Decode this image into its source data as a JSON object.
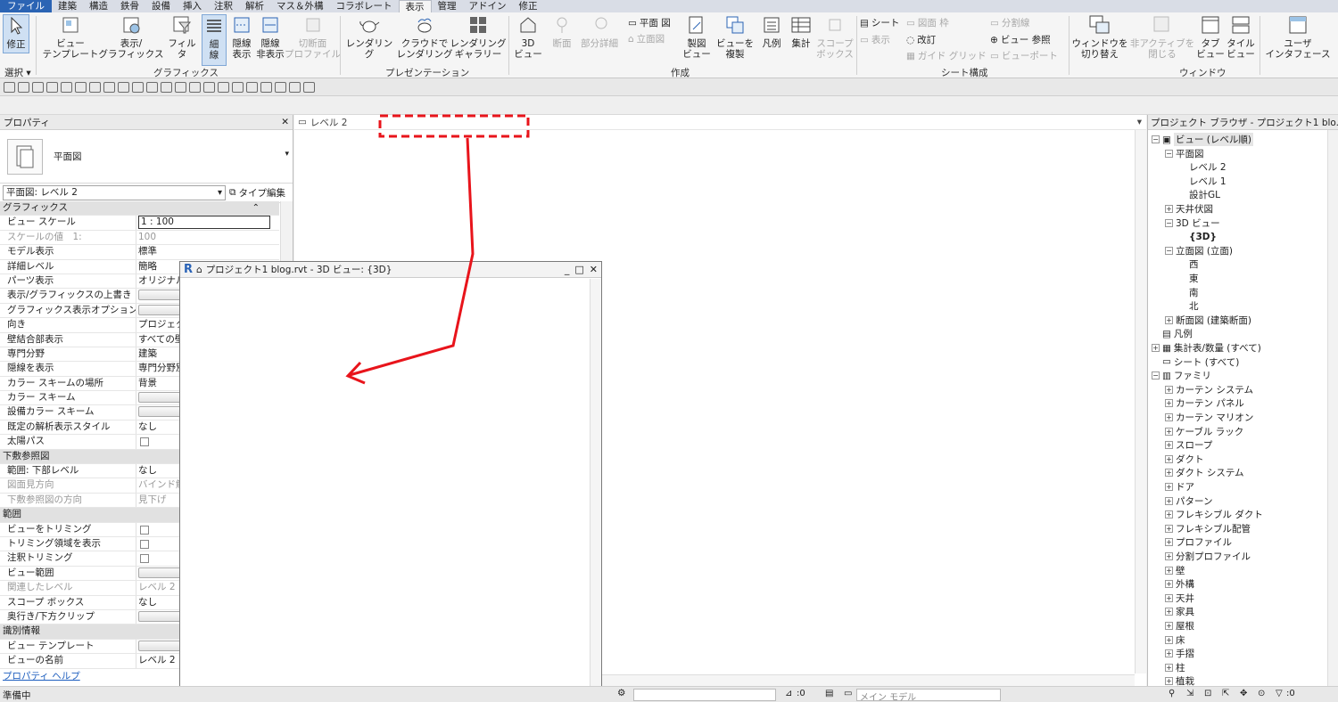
{
  "menu": [
    "ファイル",
    "建築",
    "構造",
    "鉄骨",
    "設備",
    "挿入",
    "注釈",
    "解析",
    "マス＆外構",
    "コラボレート",
    "表示",
    "管理",
    "アドイン",
    "修正"
  ],
  "ribbon": {
    "modify": "修正",
    "select": "選択 ▾",
    "view_template": "ビュー\nテンプレート",
    "vis_graphics": "表示/\nグラフィックス",
    "filter": "フィルタ",
    "thin_lines": "細\n線",
    "show_hidden": "隠線\n表示",
    "remove_hidden": "隠線\n非表示",
    "cut_profile": "切断面\nプロファイル",
    "group_graphics": "グラフィックス",
    "render": "レンダリング",
    "cloud_render": "クラウドで\nレンダリング",
    "render_gallery": "レンダリング\nギャラリー",
    "group_presentation": "プレゼンテーション",
    "view_3d": "3D\nビュー",
    "section": "断面",
    "callout": "部分詳細",
    "plan_view": "平面 図",
    "elevation": "立面図",
    "drafting_view": "製図\nビュー",
    "duplicate_view": "ビューを\n複製",
    "legends": "凡例",
    "schedules": "集計",
    "scope_box": "スコープ\nボックス",
    "group_create": "作成",
    "sheet": "シート",
    "title_block": "図面 枠",
    "view": "表示",
    "revision": "改訂",
    "guide_grid": "ガイド グリッド",
    "matchline": "分割線",
    "view_reference": "ビュー 参照",
    "viewports": "ビューポート",
    "group_sheet": "シート構成",
    "switch_windows": "ウィンドウを\n切り替え",
    "close_inactive": "非アクティブを\n閉じる",
    "tab_views": "タブ\nビュー",
    "tile_views": "タイル\nビュー",
    "group_window": "ウィンドウ",
    "user_interface": "ユーザ\nインタフェース"
  },
  "properties": {
    "title": "プロパティ",
    "type_name": "平面図",
    "instance_selector": "平面図: レベル 2",
    "edit_type": "タイプ編集",
    "help": "プロパティ ヘルプ",
    "rows": [
      {
        "k": "グラフィックス",
        "sec": true,
        "v": ""
      },
      {
        "k": "ビュー スケール",
        "v": "1 : 100",
        "kind": "input"
      },
      {
        "k": "スケールの値　1:",
        "v": "100",
        "dim": true
      },
      {
        "k": "モデル表示",
        "v": "標準"
      },
      {
        "k": "詳細レベル",
        "v": "簡略"
      },
      {
        "k": "パーツ表示",
        "v": "オリジナル"
      },
      {
        "k": "表示/グラフィックスの上書き",
        "v": "",
        "kind": "button"
      },
      {
        "k": "グラフィックス表示オプション",
        "v": "",
        "kind": "button"
      },
      {
        "k": "向き",
        "v": "プロジェクト"
      },
      {
        "k": "壁結合部表示",
        "v": "すべての壁"
      },
      {
        "k": "専門分野",
        "v": "建築"
      },
      {
        "k": "隠線を表示",
        "v": "専門分野別"
      },
      {
        "k": "カラー スキームの場所",
        "v": "背景"
      },
      {
        "k": "カラー スキーム",
        "v": "",
        "kind": "button"
      },
      {
        "k": "設備カラー スキーム",
        "v": "",
        "kind": "button"
      },
      {
        "k": "既定の解析表示スタイル",
        "v": "なし"
      },
      {
        "k": "太陽パス",
        "v": "",
        "kind": "check"
      },
      {
        "k": "下敷参照図",
        "sec": true,
        "v": ""
      },
      {
        "k": "範囲: 下部レベル",
        "v": "なし"
      },
      {
        "k": "図面見方向",
        "v": "バインド解除",
        "dim": true
      },
      {
        "k": "下敷参照図の方向",
        "v": "見下げ",
        "dim": true
      },
      {
        "k": "範囲",
        "sec": true,
        "v": ""
      },
      {
        "k": "ビューをトリミング",
        "v": "",
        "kind": "check"
      },
      {
        "k": "トリミング領域を表示",
        "v": "",
        "kind": "check"
      },
      {
        "k": "注釈トリミング",
        "v": "",
        "kind": "check"
      },
      {
        "k": "ビュー範囲",
        "v": "",
        "kind": "button"
      },
      {
        "k": "関連したレベル",
        "v": "レベル 2",
        "dim": true
      },
      {
        "k": "スコープ ボックス",
        "v": "なし"
      },
      {
        "k": "奥行き/下方クリップ",
        "v": "",
        "kind": "button"
      },
      {
        "k": "識別情報",
        "sec": true,
        "v": ""
      },
      {
        "k": "ビュー テンプレート",
        "v": "",
        "kind": "button"
      },
      {
        "k": "ビューの名前",
        "v": "レベル 2"
      }
    ]
  },
  "view_tab": "レベル 2",
  "win3d_title": "プロジェクト1 blog.rvt - 3D ビュー: {3D}",
  "browser": {
    "title": "プロジェクト ブラウザ - プロジェクト1 blo...",
    "nodes": [
      {
        "t": "ビュー (レベル順)",
        "lvl": 0,
        "exp": "−",
        "icon": "views",
        "hl": true
      },
      {
        "t": "平面図",
        "lvl": 1,
        "exp": "−"
      },
      {
        "t": "レベル 2",
        "lvl": 2
      },
      {
        "t": "レベル 1",
        "lvl": 2
      },
      {
        "t": "設計GL",
        "lvl": 2
      },
      {
        "t": "天井伏図",
        "lvl": 1,
        "exp": "+"
      },
      {
        "t": "3D ビュー",
        "lvl": 1,
        "exp": "−"
      },
      {
        "t": "{3D}",
        "lvl": 2,
        "bold": true
      },
      {
        "t": "立面図 (立面)",
        "lvl": 1,
        "exp": "−"
      },
      {
        "t": "西",
        "lvl": 2
      },
      {
        "t": "東",
        "lvl": 2
      },
      {
        "t": "南",
        "lvl": 2
      },
      {
        "t": "北",
        "lvl": 2
      },
      {
        "t": "断面図 (建築断面)",
        "lvl": 1,
        "exp": "+"
      },
      {
        "t": "凡例",
        "lvl": 0,
        "icon": "legend"
      },
      {
        "t": "集計表/数量 (すべて)",
        "lvl": 0,
        "exp": "+",
        "icon": "schedule"
      },
      {
        "t": "シート (すべて)",
        "lvl": 0,
        "icon": "sheet"
      },
      {
        "t": "ファミリ",
        "lvl": 0,
        "exp": "−",
        "icon": "family"
      },
      {
        "t": "カーテン システム",
        "lvl": 1,
        "exp": "+"
      },
      {
        "t": "カーテン パネル",
        "lvl": 1,
        "exp": "+"
      },
      {
        "t": "カーテン マリオン",
        "lvl": 1,
        "exp": "+"
      },
      {
        "t": "ケーブル ラック",
        "lvl": 1,
        "exp": "+"
      },
      {
        "t": "スロープ",
        "lvl": 1,
        "exp": "+"
      },
      {
        "t": "ダクト",
        "lvl": 1,
        "exp": "+"
      },
      {
        "t": "ダクト システム",
        "lvl": 1,
        "exp": "+"
      },
      {
        "t": "ドア",
        "lvl": 1,
        "exp": "+"
      },
      {
        "t": "パターン",
        "lvl": 1,
        "exp": "+"
      },
      {
        "t": "フレキシブル ダクト",
        "lvl": 1,
        "exp": "+"
      },
      {
        "t": "フレキシブル配管",
        "lvl": 1,
        "exp": "+"
      },
      {
        "t": "プロファイル",
        "lvl": 1,
        "exp": "+"
      },
      {
        "t": "分割プロファイル",
        "lvl": 1,
        "exp": "+"
      },
      {
        "t": "壁",
        "lvl": 1,
        "exp": "+"
      },
      {
        "t": "外構",
        "lvl": 1,
        "exp": "+"
      },
      {
        "t": "天井",
        "lvl": 1,
        "exp": "+"
      },
      {
        "t": "家具",
        "lvl": 1,
        "exp": "+"
      },
      {
        "t": "屋根",
        "lvl": 1,
        "exp": "+"
      },
      {
        "t": "床",
        "lvl": 1,
        "exp": "+"
      },
      {
        "t": "手摺",
        "lvl": 1,
        "exp": "+"
      },
      {
        "t": "柱",
        "lvl": 1,
        "exp": "+"
      },
      {
        "t": "植栽",
        "lvl": 1,
        "exp": "+"
      }
    ]
  },
  "status": {
    "text": "準備中",
    "count1": ":0",
    "model": "メイン モデル",
    "count2": ":0"
  },
  "colors": {
    "annotation": "#e8141b",
    "file_tab": "#2b64b4"
  }
}
